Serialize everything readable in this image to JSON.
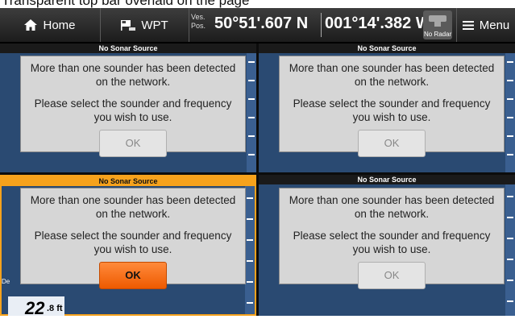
{
  "caption": "Transparent top bar overlaid on the page",
  "topbar": {
    "home_label": "Home",
    "wpt_label": "WPT",
    "pos_label_1": "Ves.",
    "pos_label_2": "Pos.",
    "latitude": "50°51'.607 N",
    "longitude": "001°14'.382 W",
    "radar_label": "No Radar",
    "menu_label": "Menu"
  },
  "panes": [
    {
      "title": "No Sonar Source",
      "msg1": "More than one sounder has been detected on the network.",
      "msg2": "Please select the sounder and frequency you wish to use.",
      "ok": "OK"
    },
    {
      "title": "No Sonar Source",
      "msg1": "More than one sounder has been detected on the network.",
      "msg2": "Please select the sounder and frequency you wish to use.",
      "ok": "OK"
    },
    {
      "title": "No Sonar Source",
      "msg1": "More than one sounder has been detected on the network.",
      "msg2": "Please select the sounder and frequency you wish to use.",
      "ok": "OK"
    },
    {
      "title": "No Sonar Source",
      "msg1": "More than one sounder has been detected on the network.",
      "msg2": "Please select the sounder and frequency you wish to use.",
      "ok": "OK"
    }
  ],
  "depth": {
    "label": "De",
    "value": "22",
    "unit": ".8 ft"
  },
  "colors": {
    "active_border": "#f6a21c",
    "ok_primary": "#ee5a00",
    "pane_bg": "#2a4a72"
  }
}
